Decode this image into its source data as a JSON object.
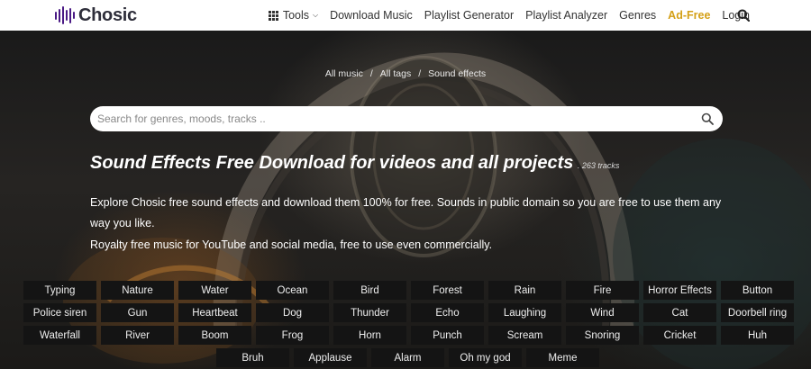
{
  "logo": {
    "text": "Chosic"
  },
  "nav": {
    "items": [
      {
        "label": "Tools",
        "icon": "grid-icon",
        "dropdown": true
      },
      {
        "label": "Download Music"
      },
      {
        "label": "Playlist Generator"
      },
      {
        "label": "Playlist Analyzer"
      },
      {
        "label": "Genres"
      },
      {
        "label": "Ad-Free",
        "highlight": "#d4a017"
      },
      {
        "label": "Login"
      }
    ],
    "search_icon": "search-icon"
  },
  "breadcrumb": [
    "All music",
    "All tags",
    "Sound effects"
  ],
  "search": {
    "placeholder": "Search for genres, moods, tracks ..",
    "value": ""
  },
  "page": {
    "title": "Sound Effects Free Download for videos and all projects",
    "track_count": ". 263 tracks",
    "description": "Explore Chosic free sound effects and download them 100% for free. Sounds in public domain so you are free to use them any way you like.",
    "description2": "Royalty free music for YouTube and social media, free to use even commercially."
  },
  "tags": [
    [
      "Typing",
      "Nature",
      "Water",
      "Ocean",
      "Bird",
      "Forest",
      "Rain",
      "Fire",
      "Horror Effects",
      "Button"
    ],
    [
      "Police siren",
      "Gun",
      "Heartbeat",
      "Dog",
      "Thunder",
      "Echo",
      "Laughing",
      "Wind",
      "Cat",
      "Doorbell ring"
    ],
    [
      "Waterfall",
      "River",
      "Boom",
      "Frog",
      "Horn",
      "Punch",
      "Scream",
      "Snoring",
      "Cricket",
      "Huh"
    ],
    [
      "Bruh",
      "Applause",
      "Alarm",
      "Oh my god",
      "Meme"
    ]
  ],
  "colors": {
    "accent": "#d4a017",
    "logo": "#4a1a85",
    "tag_bg": "#141414"
  }
}
